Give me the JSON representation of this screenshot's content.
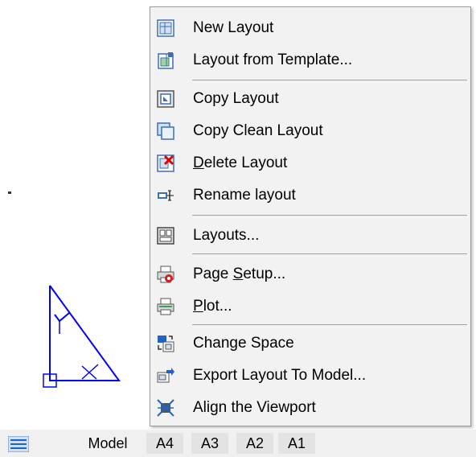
{
  "context_menu": {
    "items": [
      {
        "label": "New Layout",
        "icon": "new-layout-icon"
      },
      {
        "label": "Layout from Template...",
        "icon": "layout-template-icon"
      },
      {
        "label": "Copy Layout",
        "icon": "copy-layout-icon"
      },
      {
        "label": "Copy Clean Layout",
        "icon": "copy-clean-layout-icon"
      },
      {
        "label": "Delete Layout",
        "icon": "delete-layout-icon"
      },
      {
        "label": "Rename layout",
        "icon": "rename-layout-icon"
      },
      {
        "label": "Layouts...",
        "icon": "layouts-icon"
      },
      {
        "label": "Page Setup...",
        "icon": "page-setup-icon"
      },
      {
        "label": "Plot...",
        "icon": "plot-icon"
      },
      {
        "label": "Change Space",
        "icon": "change-space-icon"
      },
      {
        "label": "Export Layout To Model...",
        "icon": "export-layout-icon"
      },
      {
        "label": "Align the Viewport",
        "icon": "align-viewport-icon"
      }
    ]
  },
  "status_bar": {
    "menu_icon": "hamburger-icon",
    "tabs": [
      {
        "label": "Model"
      },
      {
        "label": "A4"
      },
      {
        "label": "A3"
      },
      {
        "label": "A2"
      },
      {
        "label": "A1"
      }
    ]
  },
  "colors": {
    "drawing_stroke": "#0000ff",
    "menu_background": "#f2f2f2",
    "delete_icon_red": "#e00000"
  }
}
